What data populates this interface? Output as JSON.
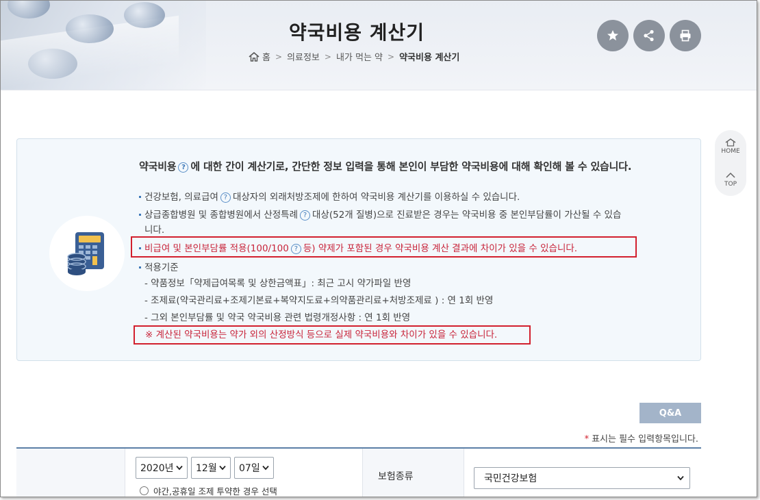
{
  "header": {
    "title": "약국비용 계산기",
    "breadcrumb": [
      "홈",
      "의료정보",
      "내가 먹는 약",
      "약국비용 계산기"
    ],
    "buttons": [
      "star-icon",
      "share-icon",
      "print-icon"
    ]
  },
  "side": {
    "home_label": "HOME",
    "top_label": "TOP"
  },
  "info": {
    "lead_prefix": "약국비용",
    "lead_suffix": "에 대한 간이 계산기로, 간단한 정보 입력을 통해 본인이 부담한 약국비용에 대해 확인해 볼 수 있습니다.",
    "item1_prefix": "건강보험, 의료급여",
    "item1_suffix": "대상자의 외래처방조제에 한하여 약국비용 계산기를 이용하실 수 있습니다.",
    "item2_prefix": "상급종합병원 및 종합병원에서 산정특례",
    "item2_suffix": "대상(52개 질병)으로 진료받은 경우는 약국비용 중 본인부담률이 가산될 수 있습",
    "item2_wrap": "니다.",
    "item3_prefix": "비급여 및 본인부담률 적용(100/100",
    "item3_suffix": "등) 약제가 포함된 경우 약국비용 계산 결과에 차이가 있을 수 있습니다.",
    "item4": "적용기준",
    "sub1": "- 약품정보「약제급여목록 및 상한금액표」: 최근 고시 약가파일 반영",
    "sub2": "- 조제료(약국관리료+조제기본료+복약지도료+의약품관리료+처방조제료 ) : 연 1회 반영",
    "sub3": "- 그외 본인부담률 및 약국 약국비용 관련 법령개정사항 : 연 1회 반영",
    "note": "※ 계산된 약국비용는 약가 외의 산정방식 등으로 실제 약국비용와 차이가 있을 수 있습니다.",
    "qmark": "?"
  },
  "qa_label": "Q&A",
  "required_note": "표시는 필수 입력항목입니다.",
  "required_star": "*",
  "form": {
    "year": "2020년",
    "month": "12월",
    "day": "07일",
    "night_option": "야간,공휴일 조제 투약한 경우 선택",
    "insurance_label": "보험종류",
    "insurance_value": "국민건강보험"
  },
  "colors": {
    "accent": "#5b7fa6",
    "highlight_red": "#d21f2d",
    "qa_bg": "#a3b4c9"
  }
}
